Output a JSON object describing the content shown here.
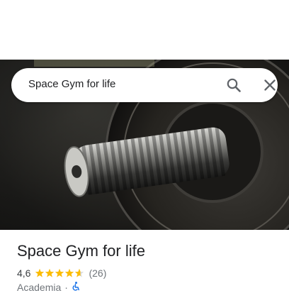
{
  "search": {
    "query": "Space Gym for life"
  },
  "icons": {
    "search": "search-icon",
    "close": "close-icon",
    "star": "star-icon",
    "accessibility": "wheelchair-icon"
  },
  "place": {
    "title": "Space Gym for life",
    "rating": "4,6",
    "stars": 4.6,
    "reviews": "(26)",
    "category": "Academia",
    "separator": "·"
  },
  "colors": {
    "star": "#fbbc04",
    "star_empty": "#dadce0",
    "accessibility": "#1a73e8",
    "text_primary": "#202124",
    "text_secondary": "#70757a"
  }
}
